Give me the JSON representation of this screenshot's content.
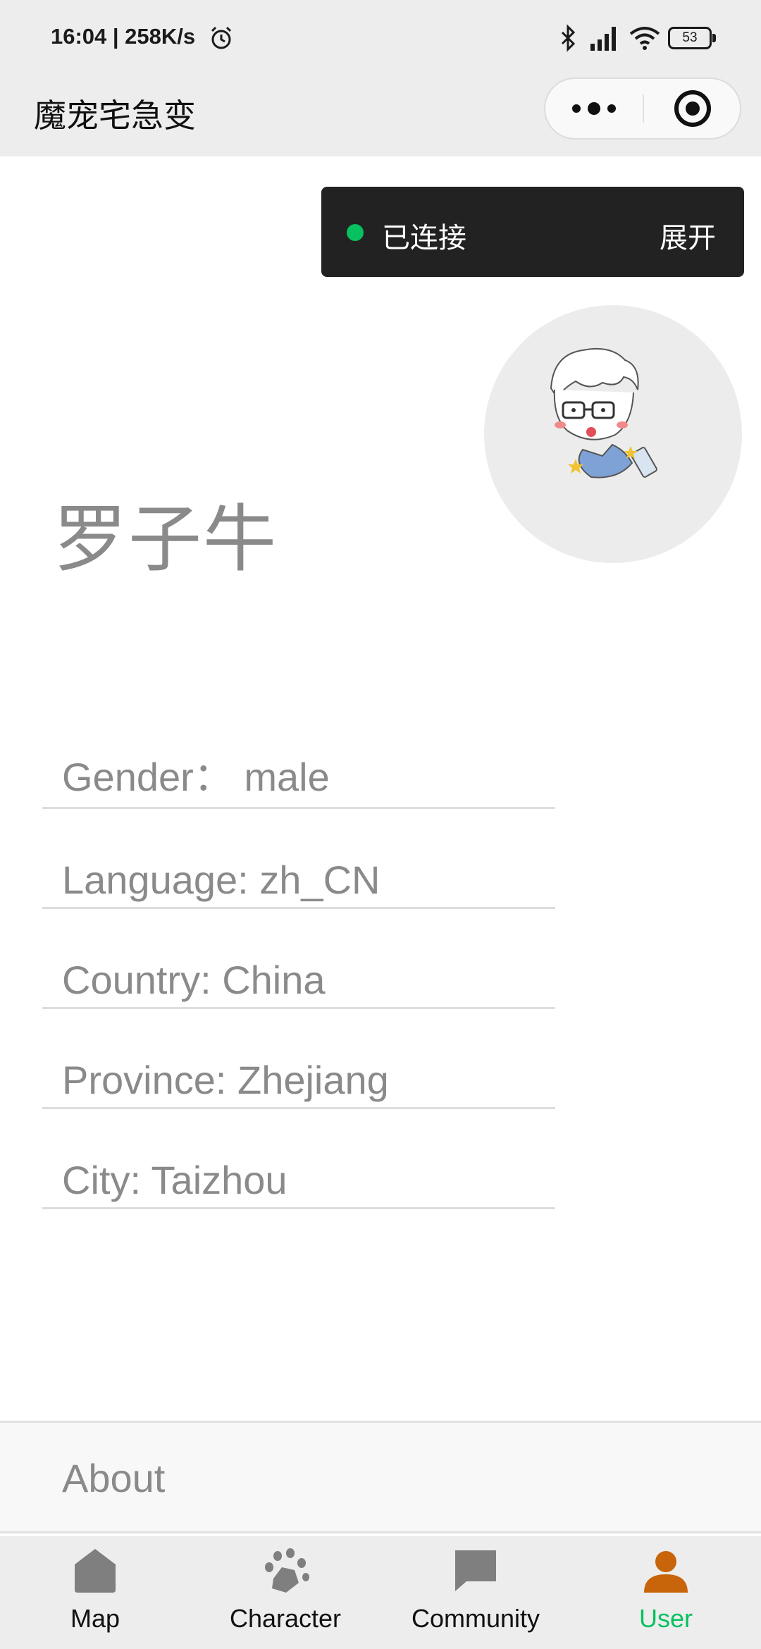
{
  "status_bar": {
    "time": "16:04 | 258K/s",
    "battery": "53"
  },
  "header": {
    "title": "魔宠宅急变"
  },
  "connection": {
    "status": "已连接",
    "expand_label": "展开",
    "dot_color": "#07c160"
  },
  "profile": {
    "name": "罗子牛",
    "avatar_icon": "cartoon-avatar"
  },
  "info": {
    "gender": "Gender：  male",
    "language": "Language: zh_CN",
    "country": "Country: China",
    "province": "Province: Zhejiang",
    "city": "City: Taizhou"
  },
  "about": {
    "label": "About"
  },
  "tabs": [
    {
      "label": "Map",
      "icon": "home-icon"
    },
    {
      "label": "Character",
      "icon": "paw-icon"
    },
    {
      "label": "Community",
      "icon": "chat-icon"
    },
    {
      "label": "User",
      "icon": "person-icon",
      "active": true
    }
  ],
  "colors": {
    "active_tab": "#07c160",
    "user_icon": "#c8640a",
    "inactive_icon": "#7f7f7f"
  }
}
